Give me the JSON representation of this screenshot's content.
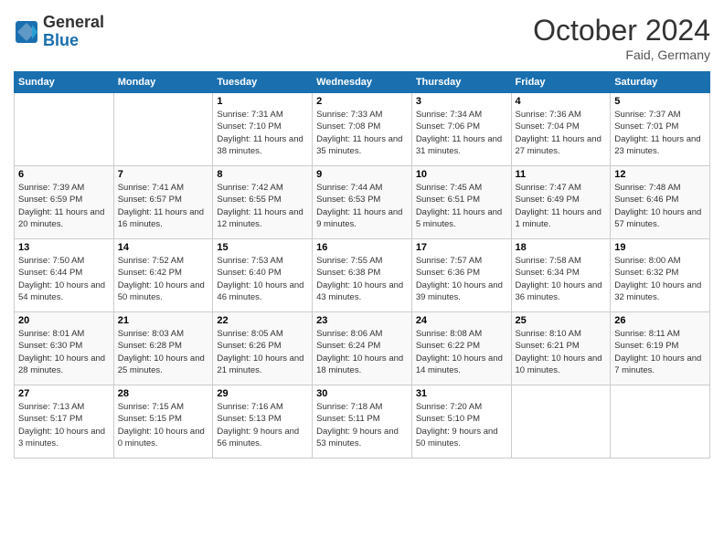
{
  "logo": {
    "general": "General",
    "blue": "Blue"
  },
  "header": {
    "month": "October 2024",
    "location": "Faid, Germany"
  },
  "weekdays": [
    "Sunday",
    "Monday",
    "Tuesday",
    "Wednesday",
    "Thursday",
    "Friday",
    "Saturday"
  ],
  "weeks": [
    [
      {
        "day": "",
        "info": ""
      },
      {
        "day": "",
        "info": ""
      },
      {
        "day": "1",
        "info": "Sunrise: 7:31 AM\nSunset: 7:10 PM\nDaylight: 11 hours and 38 minutes."
      },
      {
        "day": "2",
        "info": "Sunrise: 7:33 AM\nSunset: 7:08 PM\nDaylight: 11 hours and 35 minutes."
      },
      {
        "day": "3",
        "info": "Sunrise: 7:34 AM\nSunset: 7:06 PM\nDaylight: 11 hours and 31 minutes."
      },
      {
        "day": "4",
        "info": "Sunrise: 7:36 AM\nSunset: 7:04 PM\nDaylight: 11 hours and 27 minutes."
      },
      {
        "day": "5",
        "info": "Sunrise: 7:37 AM\nSunset: 7:01 PM\nDaylight: 11 hours and 23 minutes."
      }
    ],
    [
      {
        "day": "6",
        "info": "Sunrise: 7:39 AM\nSunset: 6:59 PM\nDaylight: 11 hours and 20 minutes."
      },
      {
        "day": "7",
        "info": "Sunrise: 7:41 AM\nSunset: 6:57 PM\nDaylight: 11 hours and 16 minutes."
      },
      {
        "day": "8",
        "info": "Sunrise: 7:42 AM\nSunset: 6:55 PM\nDaylight: 11 hours and 12 minutes."
      },
      {
        "day": "9",
        "info": "Sunrise: 7:44 AM\nSunset: 6:53 PM\nDaylight: 11 hours and 9 minutes."
      },
      {
        "day": "10",
        "info": "Sunrise: 7:45 AM\nSunset: 6:51 PM\nDaylight: 11 hours and 5 minutes."
      },
      {
        "day": "11",
        "info": "Sunrise: 7:47 AM\nSunset: 6:49 PM\nDaylight: 11 hours and 1 minute."
      },
      {
        "day": "12",
        "info": "Sunrise: 7:48 AM\nSunset: 6:46 PM\nDaylight: 10 hours and 57 minutes."
      }
    ],
    [
      {
        "day": "13",
        "info": "Sunrise: 7:50 AM\nSunset: 6:44 PM\nDaylight: 10 hours and 54 minutes."
      },
      {
        "day": "14",
        "info": "Sunrise: 7:52 AM\nSunset: 6:42 PM\nDaylight: 10 hours and 50 minutes."
      },
      {
        "day": "15",
        "info": "Sunrise: 7:53 AM\nSunset: 6:40 PM\nDaylight: 10 hours and 46 minutes."
      },
      {
        "day": "16",
        "info": "Sunrise: 7:55 AM\nSunset: 6:38 PM\nDaylight: 10 hours and 43 minutes."
      },
      {
        "day": "17",
        "info": "Sunrise: 7:57 AM\nSunset: 6:36 PM\nDaylight: 10 hours and 39 minutes."
      },
      {
        "day": "18",
        "info": "Sunrise: 7:58 AM\nSunset: 6:34 PM\nDaylight: 10 hours and 36 minutes."
      },
      {
        "day": "19",
        "info": "Sunrise: 8:00 AM\nSunset: 6:32 PM\nDaylight: 10 hours and 32 minutes."
      }
    ],
    [
      {
        "day": "20",
        "info": "Sunrise: 8:01 AM\nSunset: 6:30 PM\nDaylight: 10 hours and 28 minutes."
      },
      {
        "day": "21",
        "info": "Sunrise: 8:03 AM\nSunset: 6:28 PM\nDaylight: 10 hours and 25 minutes."
      },
      {
        "day": "22",
        "info": "Sunrise: 8:05 AM\nSunset: 6:26 PM\nDaylight: 10 hours and 21 minutes."
      },
      {
        "day": "23",
        "info": "Sunrise: 8:06 AM\nSunset: 6:24 PM\nDaylight: 10 hours and 18 minutes."
      },
      {
        "day": "24",
        "info": "Sunrise: 8:08 AM\nSunset: 6:22 PM\nDaylight: 10 hours and 14 minutes."
      },
      {
        "day": "25",
        "info": "Sunrise: 8:10 AM\nSunset: 6:21 PM\nDaylight: 10 hours and 10 minutes."
      },
      {
        "day": "26",
        "info": "Sunrise: 8:11 AM\nSunset: 6:19 PM\nDaylight: 10 hours and 7 minutes."
      }
    ],
    [
      {
        "day": "27",
        "info": "Sunrise: 7:13 AM\nSunset: 5:17 PM\nDaylight: 10 hours and 3 minutes."
      },
      {
        "day": "28",
        "info": "Sunrise: 7:15 AM\nSunset: 5:15 PM\nDaylight: 10 hours and 0 minutes."
      },
      {
        "day": "29",
        "info": "Sunrise: 7:16 AM\nSunset: 5:13 PM\nDaylight: 9 hours and 56 minutes."
      },
      {
        "day": "30",
        "info": "Sunrise: 7:18 AM\nSunset: 5:11 PM\nDaylight: 9 hours and 53 minutes."
      },
      {
        "day": "31",
        "info": "Sunrise: 7:20 AM\nSunset: 5:10 PM\nDaylight: 9 hours and 50 minutes."
      },
      {
        "day": "",
        "info": ""
      },
      {
        "day": "",
        "info": ""
      }
    ]
  ]
}
